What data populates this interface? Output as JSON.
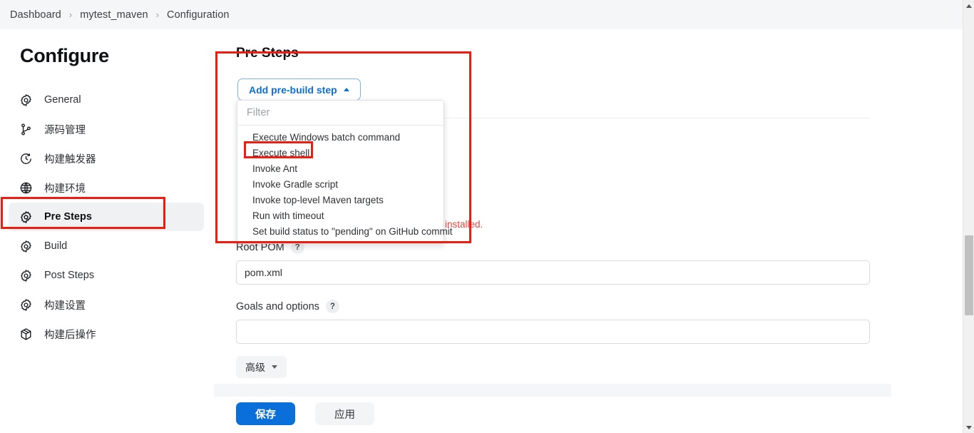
{
  "breadcrumb": {
    "items": [
      "Dashboard",
      "mytest_maven",
      "Configuration"
    ],
    "separator": "›"
  },
  "sidebar": {
    "title": "Configure",
    "items": [
      {
        "label": "General",
        "icon": "gear-icon",
        "active": false
      },
      {
        "label": "源码管理",
        "icon": "branch-icon",
        "active": false
      },
      {
        "label": "构建触发器",
        "icon": "clock-icon",
        "active": false
      },
      {
        "label": "构建环境",
        "icon": "globe-icon",
        "active": false
      },
      {
        "label": "Pre Steps",
        "icon": "gear-icon",
        "active": true
      },
      {
        "label": "Build",
        "icon": "gear-icon",
        "active": false
      },
      {
        "label": "Post Steps",
        "icon": "gear-icon",
        "active": false
      },
      {
        "label": "构建设置",
        "icon": "gear-icon",
        "active": false
      },
      {
        "label": "构建后操作",
        "icon": "package-icon",
        "active": false
      }
    ]
  },
  "main": {
    "section_title": "Pre Steps",
    "installed_note": "installed.",
    "add_step_button": {
      "label": "Add pre-build step",
      "caret": "caret-up-icon"
    },
    "dropdown": {
      "filter_placeholder": "Filter",
      "filter_value": "",
      "items": [
        "Execute Windows batch command",
        "Execute shell",
        "Invoke Ant",
        "Invoke Gradle script",
        "Invoke top-level Maven targets",
        "Run with timeout",
        "Set build status to \"pending\" on GitHub commit"
      ],
      "highlighted_item": "Execute shell"
    },
    "fields": [
      {
        "label": "Root POM",
        "help": "?",
        "value": "pom.xml",
        "placeholder": ""
      },
      {
        "label": "Goals and options",
        "help": "?",
        "value": "",
        "placeholder": ""
      }
    ],
    "advanced_button": "高级",
    "save_button": "保存",
    "apply_button": "应用"
  },
  "colors": {
    "accent_blue": "#0a6fd8",
    "annotation_red": "#f01c10",
    "warning_red": "#e8453c",
    "bar_grey": "#f5f6f7"
  }
}
